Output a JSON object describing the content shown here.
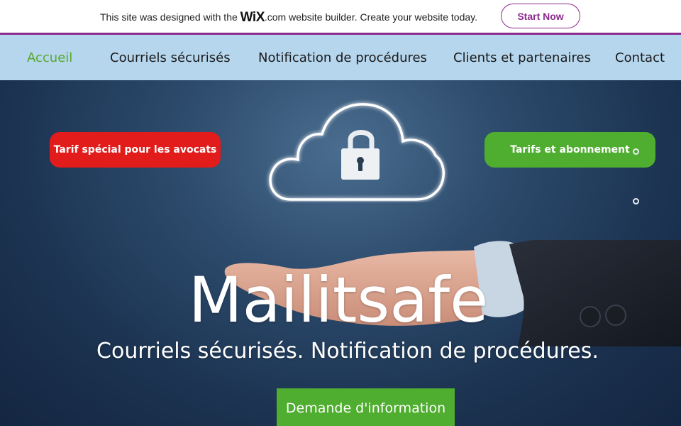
{
  "wix_banner": {
    "text_before": "This site was designed with the ",
    "logo": "WiX",
    "logo_suffix": ".com",
    "text_after": " website builder. Create your website today.",
    "start_now_label": "Start Now",
    "accent_color": "#8b2c8f"
  },
  "nav": {
    "items": [
      {
        "label": "Accueil",
        "active": true
      },
      {
        "label": "Courriels sécurisés",
        "active": false
      },
      {
        "label": "Notification de procédures",
        "active": false
      },
      {
        "label": "Clients et partenaires",
        "active": false
      },
      {
        "label": "Contact",
        "active": false
      }
    ],
    "background": "#b6d6ee",
    "active_color": "#58a82a"
  },
  "hero": {
    "left_button_label": "Tarif spécial pour les avocats",
    "right_button_label": "Tarifs et abonnement",
    "title": "Mailitsafe",
    "subtitle": "Courriels sécurisés. Notification de procédures.",
    "cta_label": "Demande d'information",
    "red_color": "#e21b1b",
    "green_color": "#4fad2f",
    "icons": [
      "cloud-lock-icon"
    ]
  }
}
